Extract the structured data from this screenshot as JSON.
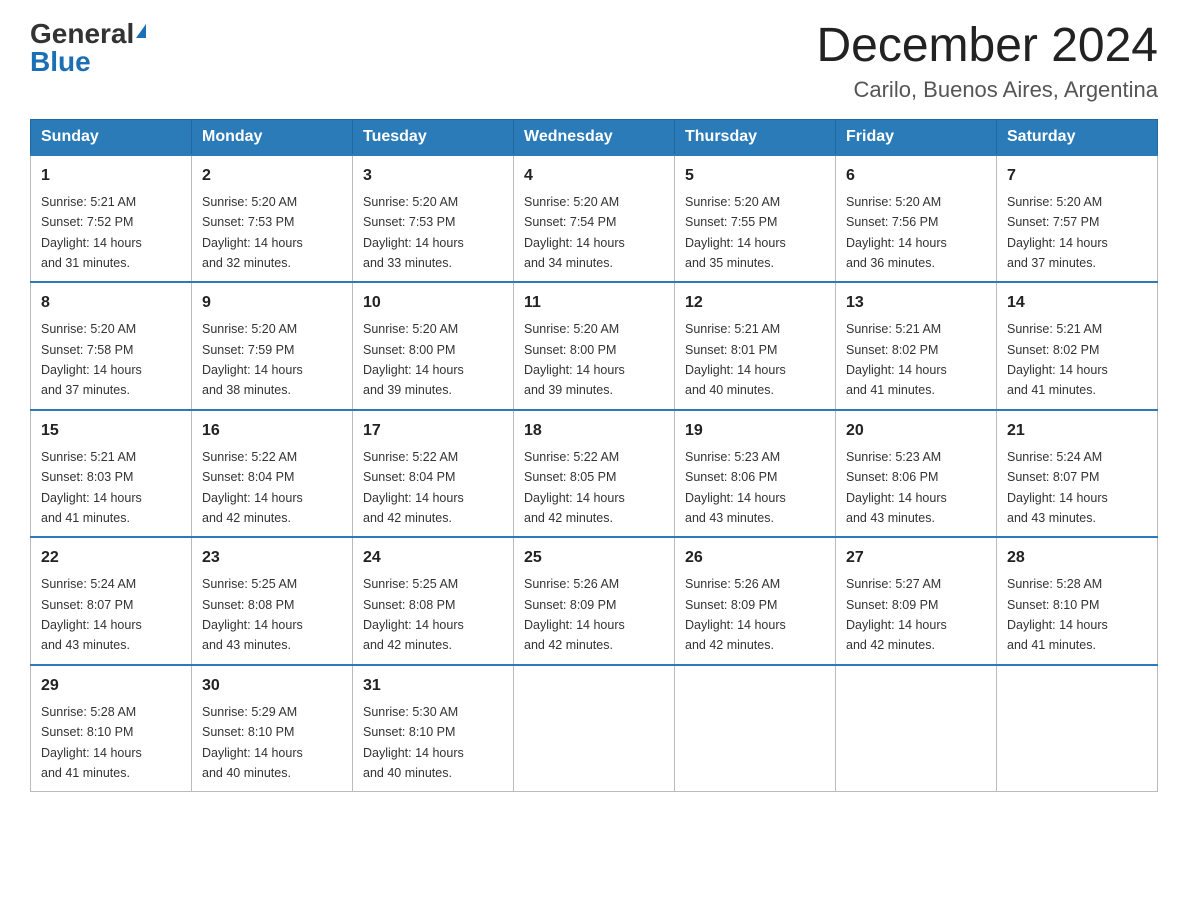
{
  "header": {
    "logo_general": "General",
    "logo_blue": "Blue",
    "month_title": "December 2024",
    "location": "Carilo, Buenos Aires, Argentina"
  },
  "days_of_week": [
    "Sunday",
    "Monday",
    "Tuesday",
    "Wednesday",
    "Thursday",
    "Friday",
    "Saturday"
  ],
  "weeks": [
    [
      {
        "day": "1",
        "sunrise": "5:21 AM",
        "sunset": "7:52 PM",
        "daylight": "14 hours and 31 minutes."
      },
      {
        "day": "2",
        "sunrise": "5:20 AM",
        "sunset": "7:53 PM",
        "daylight": "14 hours and 32 minutes."
      },
      {
        "day": "3",
        "sunrise": "5:20 AM",
        "sunset": "7:53 PM",
        "daylight": "14 hours and 33 minutes."
      },
      {
        "day": "4",
        "sunrise": "5:20 AM",
        "sunset": "7:54 PM",
        "daylight": "14 hours and 34 minutes."
      },
      {
        "day": "5",
        "sunrise": "5:20 AM",
        "sunset": "7:55 PM",
        "daylight": "14 hours and 35 minutes."
      },
      {
        "day": "6",
        "sunrise": "5:20 AM",
        "sunset": "7:56 PM",
        "daylight": "14 hours and 36 minutes."
      },
      {
        "day": "7",
        "sunrise": "5:20 AM",
        "sunset": "7:57 PM",
        "daylight": "14 hours and 37 minutes."
      }
    ],
    [
      {
        "day": "8",
        "sunrise": "5:20 AM",
        "sunset": "7:58 PM",
        "daylight": "14 hours and 37 minutes."
      },
      {
        "day": "9",
        "sunrise": "5:20 AM",
        "sunset": "7:59 PM",
        "daylight": "14 hours and 38 minutes."
      },
      {
        "day": "10",
        "sunrise": "5:20 AM",
        "sunset": "8:00 PM",
        "daylight": "14 hours and 39 minutes."
      },
      {
        "day": "11",
        "sunrise": "5:20 AM",
        "sunset": "8:00 PM",
        "daylight": "14 hours and 39 minutes."
      },
      {
        "day": "12",
        "sunrise": "5:21 AM",
        "sunset": "8:01 PM",
        "daylight": "14 hours and 40 minutes."
      },
      {
        "day": "13",
        "sunrise": "5:21 AM",
        "sunset": "8:02 PM",
        "daylight": "14 hours and 41 minutes."
      },
      {
        "day": "14",
        "sunrise": "5:21 AM",
        "sunset": "8:02 PM",
        "daylight": "14 hours and 41 minutes."
      }
    ],
    [
      {
        "day": "15",
        "sunrise": "5:21 AM",
        "sunset": "8:03 PM",
        "daylight": "14 hours and 41 minutes."
      },
      {
        "day": "16",
        "sunrise": "5:22 AM",
        "sunset": "8:04 PM",
        "daylight": "14 hours and 42 minutes."
      },
      {
        "day": "17",
        "sunrise": "5:22 AM",
        "sunset": "8:04 PM",
        "daylight": "14 hours and 42 minutes."
      },
      {
        "day": "18",
        "sunrise": "5:22 AM",
        "sunset": "8:05 PM",
        "daylight": "14 hours and 42 minutes."
      },
      {
        "day": "19",
        "sunrise": "5:23 AM",
        "sunset": "8:06 PM",
        "daylight": "14 hours and 43 minutes."
      },
      {
        "day": "20",
        "sunrise": "5:23 AM",
        "sunset": "8:06 PM",
        "daylight": "14 hours and 43 minutes."
      },
      {
        "day": "21",
        "sunrise": "5:24 AM",
        "sunset": "8:07 PM",
        "daylight": "14 hours and 43 minutes."
      }
    ],
    [
      {
        "day": "22",
        "sunrise": "5:24 AM",
        "sunset": "8:07 PM",
        "daylight": "14 hours and 43 minutes."
      },
      {
        "day": "23",
        "sunrise": "5:25 AM",
        "sunset": "8:08 PM",
        "daylight": "14 hours and 43 minutes."
      },
      {
        "day": "24",
        "sunrise": "5:25 AM",
        "sunset": "8:08 PM",
        "daylight": "14 hours and 42 minutes."
      },
      {
        "day": "25",
        "sunrise": "5:26 AM",
        "sunset": "8:09 PM",
        "daylight": "14 hours and 42 minutes."
      },
      {
        "day": "26",
        "sunrise": "5:26 AM",
        "sunset": "8:09 PM",
        "daylight": "14 hours and 42 minutes."
      },
      {
        "day": "27",
        "sunrise": "5:27 AM",
        "sunset": "8:09 PM",
        "daylight": "14 hours and 42 minutes."
      },
      {
        "day": "28",
        "sunrise": "5:28 AM",
        "sunset": "8:10 PM",
        "daylight": "14 hours and 41 minutes."
      }
    ],
    [
      {
        "day": "29",
        "sunrise": "5:28 AM",
        "sunset": "8:10 PM",
        "daylight": "14 hours and 41 minutes."
      },
      {
        "day": "30",
        "sunrise": "5:29 AM",
        "sunset": "8:10 PM",
        "daylight": "14 hours and 40 minutes."
      },
      {
        "day": "31",
        "sunrise": "5:30 AM",
        "sunset": "8:10 PM",
        "daylight": "14 hours and 40 minutes."
      },
      null,
      null,
      null,
      null
    ]
  ],
  "labels": {
    "sunrise": "Sunrise:",
    "sunset": "Sunset:",
    "daylight": "Daylight:"
  }
}
